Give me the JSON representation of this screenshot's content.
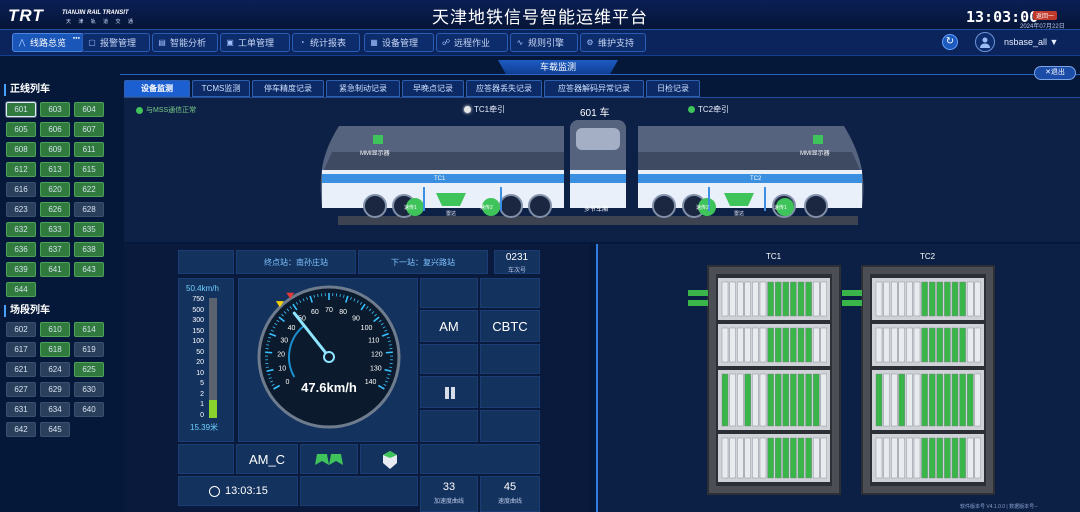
{
  "header": {
    "logo_mark": "TRT",
    "logo_en": "TIANJIN RAIL TRANSIT",
    "logo_cn": "天 津 轨 道 交 通",
    "title": "天津地铁信号智能运维平台",
    "clock": "13:03:00",
    "version_badge": "返回一",
    "date": "2024年07月22日"
  },
  "nav": [
    {
      "label": "线路总览",
      "icon": "line-overview-icon",
      "active": true,
      "badge": "●●●"
    },
    {
      "label": "报警管理",
      "icon": "alarm-icon",
      "active": false
    },
    {
      "label": "智能分析",
      "icon": "analysis-icon",
      "active": false
    },
    {
      "label": "工单管理",
      "icon": "workorder-icon",
      "active": false
    },
    {
      "label": "统计报表",
      "icon": "report-icon",
      "active": false
    },
    {
      "label": "设备管理",
      "icon": "device-icon",
      "active": false
    },
    {
      "label": "远程作业",
      "icon": "remote-icon",
      "active": false
    },
    {
      "label": "规则引擎",
      "icon": "rule-icon",
      "active": false
    },
    {
      "label": "维护支持",
      "icon": "support-icon",
      "active": false
    }
  ],
  "user": {
    "name": "nsbase_all ▼"
  },
  "page": {
    "subtitle": "车载监测",
    "exit": "✕退出"
  },
  "sidebar": {
    "mainline_title": "正线列车",
    "mainline": [
      {
        "id": "601",
        "state": "sel"
      },
      {
        "id": "603",
        "state": "green"
      },
      {
        "id": "604",
        "state": "green"
      },
      {
        "id": "605",
        "state": "green"
      },
      {
        "id": "606",
        "state": "green"
      },
      {
        "id": "607",
        "state": "green"
      },
      {
        "id": "608",
        "state": "green"
      },
      {
        "id": "609",
        "state": "green"
      },
      {
        "id": "611",
        "state": "green"
      },
      {
        "id": "612",
        "state": "green"
      },
      {
        "id": "613",
        "state": "green"
      },
      {
        "id": "615",
        "state": "green"
      },
      {
        "id": "616",
        "state": "gray"
      },
      {
        "id": "620",
        "state": "green"
      },
      {
        "id": "622",
        "state": "green"
      },
      {
        "id": "623",
        "state": "gray"
      },
      {
        "id": "626",
        "state": "green"
      },
      {
        "id": "628",
        "state": "gray"
      },
      {
        "id": "632",
        "state": "green"
      },
      {
        "id": "633",
        "state": "green"
      },
      {
        "id": "635",
        "state": "green"
      },
      {
        "id": "636",
        "state": "green"
      },
      {
        "id": "637",
        "state": "green"
      },
      {
        "id": "638",
        "state": "green"
      },
      {
        "id": "639",
        "state": "green"
      },
      {
        "id": "641",
        "state": "green"
      },
      {
        "id": "643",
        "state": "green"
      },
      {
        "id": "644",
        "state": "green"
      }
    ],
    "depot_title": "场段列车",
    "depot": [
      {
        "id": "602",
        "state": "gray"
      },
      {
        "id": "610",
        "state": "green"
      },
      {
        "id": "614",
        "state": "green"
      },
      {
        "id": "617",
        "state": "gray"
      },
      {
        "id": "618",
        "state": "green"
      },
      {
        "id": "619",
        "state": "gray"
      },
      {
        "id": "621",
        "state": "gray"
      },
      {
        "id": "624",
        "state": "gray"
      },
      {
        "id": "625",
        "state": "green"
      },
      {
        "id": "627",
        "state": "gray"
      },
      {
        "id": "629",
        "state": "gray"
      },
      {
        "id": "630",
        "state": "gray"
      },
      {
        "id": "631",
        "state": "gray"
      },
      {
        "id": "634",
        "state": "gray"
      },
      {
        "id": "640",
        "state": "gray"
      },
      {
        "id": "642",
        "state": "gray"
      },
      {
        "id": "645",
        "state": "gray"
      }
    ]
  },
  "tabs": [
    "设备监测",
    "TCMS监测",
    "停车精度记录",
    "紧急制动记录",
    "早晚点记录",
    "应答器丢失记录",
    "应答器解码异常记录",
    "日检记录"
  ],
  "train": {
    "mss_status": "与MSS通信正常",
    "tc1_label": "TC1牵引",
    "car_no": "601 车",
    "tc2_label": "TC2牵引",
    "mmi1": "MMI显示器",
    "mmi2": "MMI显示器",
    "tc1": "TC1",
    "tc2": "TC2",
    "speed1a": "速传1",
    "speed1b": "速传2",
    "radar1": "雷达",
    "speed2a": "速传2",
    "speed2b": "速传1",
    "radar2": "雷达",
    "middle": "多节车厢"
  },
  "status": {
    "terminal": "终点站：南孙庄站",
    "next": "下一站：复兴路站",
    "train_no": "0231",
    "train_no_label": "车次号",
    "mode": "AM",
    "signal": "CBTC",
    "pause_icon": "pause-icon",
    "drive_mode": "AM_C",
    "time": "13:03:15",
    "acc_count": "33",
    "acc_label": "加速度曲线",
    "acc2_count": "45",
    "acc2_label": "速度曲线"
  },
  "gauge": {
    "limit": "50.4km/h",
    "current": "47.6km/h",
    "value": 47.6,
    "max": 140,
    "ticks": [
      "0",
      "10",
      "20",
      "30",
      "40",
      "50",
      "60",
      "70",
      "80",
      "90",
      "100",
      "110",
      "120",
      "130",
      "140"
    ]
  },
  "distance": {
    "labels": [
      "750",
      "500",
      "300",
      "150",
      "100",
      "50",
      "20",
      "10",
      "5",
      "2",
      "1",
      "0"
    ],
    "value": "15.39米",
    "fill_fraction": 0.15
  },
  "cabinet": {
    "left": "TC1",
    "right": "TC2"
  },
  "footer": {
    "version": "软件版本号 V4.1.0.0 | 数据版本号--"
  }
}
